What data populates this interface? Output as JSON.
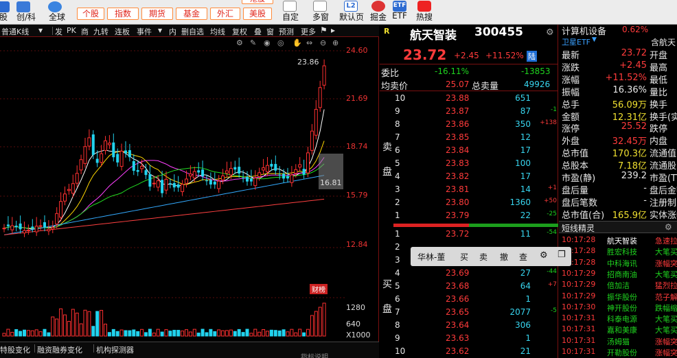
{
  "toolbar": {
    "items": [
      {
        "label": "股"
      },
      {
        "label": "创/科"
      },
      {
        "label": "全球"
      },
      {
        "label": "自定"
      },
      {
        "label": "多窗"
      },
      {
        "label": "默认页"
      },
      {
        "label": "掘金"
      },
      {
        "label": "ETF"
      },
      {
        "label": "热搜"
      }
    ],
    "tabs": [
      "个股",
      "指数",
      "期货",
      "基金",
      "外汇",
      "美股"
    ],
    "top_tab": "港股",
    "icon_labels": {
      "l2": "L2",
      "etf": "ETF"
    }
  },
  "chart": {
    "toolbar": [
      "普通K线",
      "发",
      "PK",
      "商",
      "九转",
      "连板",
      "事件",
      "内",
      "删自选",
      "均线",
      "复权",
      "叠",
      "窗",
      "预测",
      "更多"
    ],
    "price_labels": [
      "24.60",
      "21.69",
      "18.74",
      "15.79",
      "12.84"
    ],
    "high_marker": "23.86",
    "low_marker": "16.81",
    "badge": "财榜",
    "volume_labels": [
      "1280",
      "640",
      "X1000"
    ],
    "bottom_tabs": [
      "特股变化",
      "融资融券变化",
      "机构探测器"
    ],
    "bottom_right_hint": "指标说明",
    "colors": {
      "up": "#ff3030",
      "down": "#22d3ee",
      "ma1": "#ffffff",
      "ma2": "#ffd700",
      "ma3": "#ff40ff",
      "ma4": "#22dd22",
      "ma5": "#33aaff",
      "ma6": "#ff4040"
    }
  },
  "quote": {
    "logo": "R",
    "name": "航天智装",
    "code": "300455",
    "price": "23.72",
    "change": "+2.45",
    "change_pct": "+11.52%",
    "badge": "陆",
    "weibi_label": "委比",
    "weibi_pct": "-16.11%",
    "weibi_val": "-13853",
    "avg_label": "均卖价",
    "avg_val": "25.07",
    "total_label": "总卖量",
    "total_val": "49926",
    "sell_side_label": [
      "卖",
      "盘"
    ],
    "buy_side_label": [
      "买",
      "盘"
    ],
    "asks": [
      {
        "lvl": "10",
        "price": "23.88",
        "vol": "651",
        "delta": ""
      },
      {
        "lvl": "9",
        "price": "23.87",
        "vol": "87",
        "delta": "-1"
      },
      {
        "lvl": "8",
        "price": "23.86",
        "vol": "350",
        "delta": "+138"
      },
      {
        "lvl": "7",
        "price": "23.85",
        "vol": "12",
        "delta": ""
      },
      {
        "lvl": "6",
        "price": "23.84",
        "vol": "17",
        "delta": ""
      },
      {
        "lvl": "5",
        "price": "23.83",
        "vol": "100",
        "delta": ""
      },
      {
        "lvl": "4",
        "price": "23.82",
        "vol": "17",
        "delta": ""
      },
      {
        "lvl": "3",
        "price": "23.81",
        "vol": "14",
        "delta": "+1"
      },
      {
        "lvl": "2",
        "price": "23.80",
        "vol": "1360",
        "delta": "+50"
      },
      {
        "lvl": "1",
        "price": "23.79",
        "vol": "22",
        "delta": "-25"
      }
    ],
    "bids": [
      {
        "lvl": "1",
        "price": "23.72",
        "vol": "11",
        "delta": "-54"
      },
      {
        "lvl": "2",
        "price": "",
        "vol": "",
        "delta": ""
      },
      {
        "lvl": "3",
        "price": "",
        "vol": "",
        "delta": ""
      },
      {
        "lvl": "4",
        "price": "23.69",
        "vol": "27",
        "delta": "-44"
      },
      {
        "lvl": "5",
        "price": "23.68",
        "vol": "64",
        "delta": "+7"
      },
      {
        "lvl": "6",
        "price": "23.66",
        "vol": "1",
        "delta": ""
      },
      {
        "lvl": "7",
        "price": "23.65",
        "vol": "2077",
        "delta": "-5"
      },
      {
        "lvl": "8",
        "price": "23.64",
        "vol": "306",
        "delta": ""
      },
      {
        "lvl": "9",
        "price": "23.63",
        "vol": "1",
        "delta": ""
      },
      {
        "lvl": "10",
        "price": "23.62",
        "vol": "21",
        "delta": ""
      }
    ]
  },
  "popup": {
    "items": [
      "华林-董",
      "买",
      "卖",
      "撤",
      "查"
    ]
  },
  "sector": {
    "name": "计算机设备",
    "pct": "0.62%",
    "etf": "卫星ETF",
    "etf_right": "含航天",
    "stats": [
      {
        "label": "最新",
        "value": "23.72",
        "right": "开盘"
      },
      {
        "label": "涨跌",
        "value": "+2.45",
        "right": "最高"
      },
      {
        "label": "涨幅",
        "value": "+11.52%",
        "right": "最低"
      },
      {
        "label": "振幅",
        "value": "16.36%",
        "right": "量比"
      },
      {
        "label": "总手",
        "value": "56.09万",
        "right": "换手"
      },
      {
        "label": "金额",
        "value": "12.31亿",
        "right": "换手(实"
      },
      {
        "label": "涨停",
        "value": "25.52",
        "right": "跌停"
      },
      {
        "label": "外盘",
        "value": "32.45万",
        "right": "内盘"
      },
      {
        "label": "总市值",
        "value": "170.3亿",
        "right": "流通值"
      },
      {
        "label": "总股本",
        "value": "7.18亿",
        "right": "流通股"
      },
      {
        "label": "市盈(静)",
        "value": "239.2",
        "right": "市盈(TTM"
      },
      {
        "label": "盘后量",
        "value": "-",
        "right": "盘后金额"
      },
      {
        "label": "盘后笔数",
        "value": "-",
        "right": "注册制"
      },
      {
        "label": "总市值(合)",
        "value": "165.9亿",
        "right": "实体涨幅"
      }
    ],
    "elf_title": "短线精灵",
    "elf": [
      {
        "time": "10:17:28",
        "name": "航天智装",
        "tag": "急速拉升"
      },
      {
        "time": "10:17:28",
        "name": "胜宏科技",
        "tag": "大笔买入"
      },
      {
        "time": "10:17:28",
        "name": "中科海讯",
        "tag": "涨幅突破"
      },
      {
        "time": "10:17:29",
        "name": "招商南油",
        "tag": "大笔买入"
      },
      {
        "time": "10:17:29",
        "name": "倍加洁",
        "tag": "猛烈拉升"
      },
      {
        "time": "10:17:29",
        "name": "振华股份",
        "tag": "范子解封"
      },
      {
        "time": "10:17:30",
        "name": "神开股份",
        "tag": "跌幅缩小"
      },
      {
        "time": "10:17:31",
        "name": "科泰电源",
        "tag": "大笔买入"
      },
      {
        "time": "10:17:31",
        "name": "嘉和美康",
        "tag": "大笔买入"
      },
      {
        "time": "10:17:31",
        "name": "汤姆猫",
        "tag": "涨幅突破"
      },
      {
        "time": "10:17:31",
        "name": "开勒股份",
        "tag": "涨幅突破"
      }
    ]
  }
}
